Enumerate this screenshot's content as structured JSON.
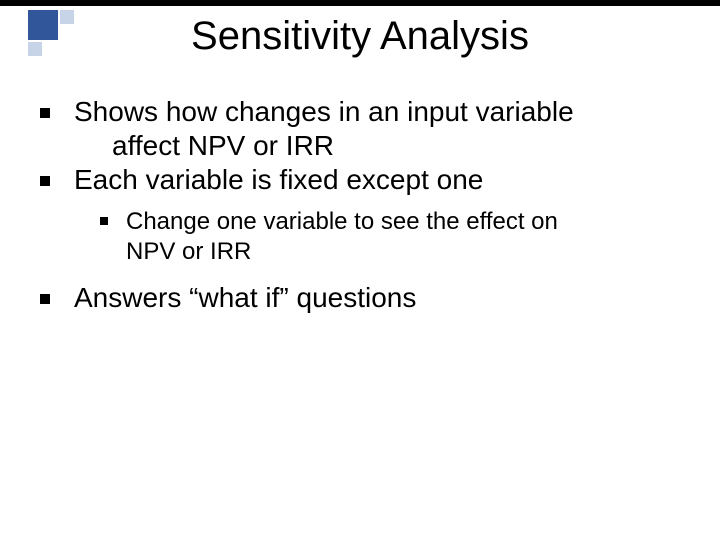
{
  "slide": {
    "title": "Sensitivity Analysis",
    "bullets": [
      {
        "line1": "Shows how changes in an input variable",
        "line2": "affect NPV or IRR"
      },
      {
        "line1": "Each variable is fixed except one"
      }
    ],
    "subbullet": {
      "line1": "Change one variable to see the effect on",
      "line2": "NPV or IRR"
    },
    "bullet3": {
      "line1": "Answers “what if” questions"
    }
  }
}
